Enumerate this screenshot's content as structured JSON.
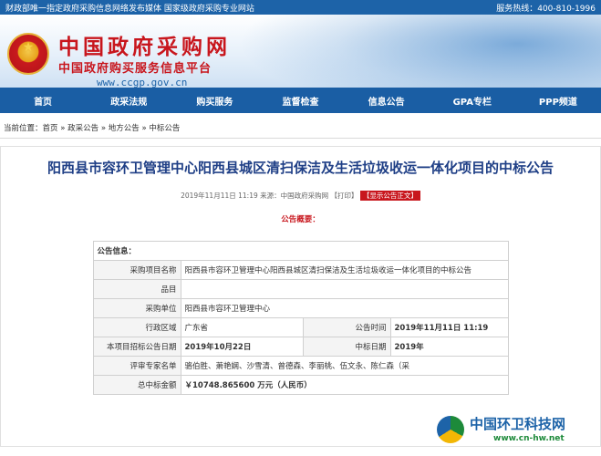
{
  "topbar": {
    "left": "财政部唯一指定政府采购信息网络发布媒体  国家级政府采购专业网站",
    "right": "服务热线：400-810-1996"
  },
  "header": {
    "site_title": "中国政府采购网",
    "site_subtitle": "中国政府购买服务信息平台",
    "site_url": "www.ccgp.gov.cn"
  },
  "nav": {
    "items": [
      "首页",
      "政采法规",
      "购买服务",
      "监督检查",
      "信息公告",
      "GPA专栏",
      "PPP频道"
    ]
  },
  "breadcrumb": {
    "prefix": "当前位置：",
    "items": [
      "首页",
      "政采公告",
      "地方公告",
      "中标公告"
    ],
    "separator": " » "
  },
  "article": {
    "title": "阳西县市容环卫管理中心阳西县城区清扫保洁及生活垃圾收运一体化项目的中标公告",
    "date": "2019年11月11日 11:19",
    "source": "来源：中国政府采购网",
    "print": "【打印】",
    "show_notice": "【显示公告正文】",
    "summary_label": "公告概要："
  },
  "info_table": {
    "section_header": "公告信息：",
    "project_name_label": "采购项目名称",
    "project_name": "阳西县市容环卫管理中心阳西县城区清扫保洁及生活垃圾收运一体化项目的中标公告",
    "item_label": "品目",
    "item": "",
    "unit_label": "采购单位",
    "unit": "阳西县市容环卫管理中心",
    "region_label": "行政区域",
    "region": "广东省",
    "publish_time_label": "公告时间",
    "publish_time": "2019年11月11日 11:19",
    "tender_date_label": "本项目招标公告日期",
    "tender_date": "2019年10月22日",
    "award_date_label": "中标日期",
    "award_date": "2019年",
    "experts_label": "评审专家名单",
    "experts": "骆伯胜、萧艳娴、沙雪清、曾德森、李丽桃、伍文永、陈仁森（采",
    "amount_label": "总中标金额",
    "amount": "￥10748.865600 万元（人民币）"
  },
  "watermark": {
    "text": "中国环卫科技网",
    "url": "www.cn-hw.net"
  }
}
